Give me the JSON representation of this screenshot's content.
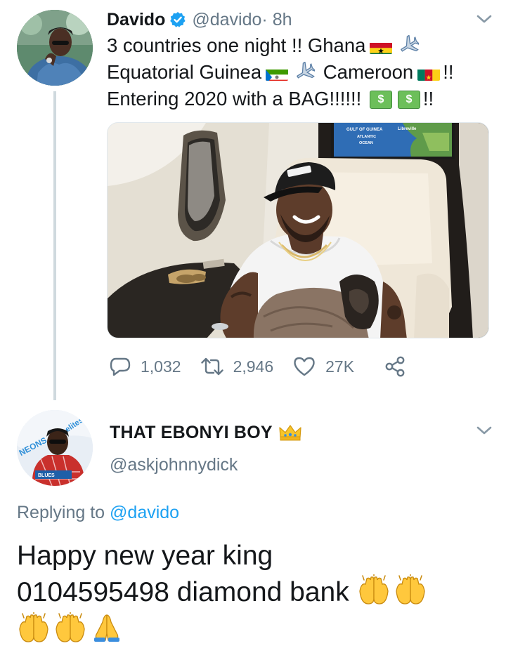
{
  "tweet": {
    "author": {
      "display_name": "Davido",
      "handle": "@davido",
      "time": " · 8h"
    },
    "text": {
      "line1": "3 countries one night !! Ghana",
      "line2_a": "Equatorial Guinea",
      "line2_b": "Cameroon",
      "line2_c": "!!",
      "line3": "Entering 2020 with a BAG!!!!!!",
      "line3_end": "!!"
    },
    "money_symbol": "$",
    "photo_screen": {
      "line1": "GULF OF GUINEA",
      "line2": "ATLANTIC",
      "line3": "OCEAN",
      "city": "Libreville"
    },
    "stats": {
      "replies": "1,032",
      "retweets": "2,946",
      "likes": "27K"
    },
    "icons": {
      "verified": "verified-badge-icon",
      "chevron": "chevron-down-icon",
      "reply": "reply-icon",
      "retweet": "retweet-icon",
      "like": "heart-icon",
      "share": "share-icon",
      "plane": "airplane-emoji",
      "crown": "crown-emoji",
      "hands": "raising-hands-emoji",
      "pray": "folded-hands-emoji"
    },
    "flags": [
      "Ghana",
      "Equatorial Guinea",
      "Cameroon"
    ]
  },
  "reply": {
    "author": {
      "display_name": "THAT EBONYI BOY",
      "handle": "@askjohnnydick"
    },
    "replying_prefix": "Replying to ",
    "replying_to": "@davido",
    "text_line1": "Happy new year king",
    "text_line2": "0104595498 diamond bank",
    "avatar_banner": "BLUES"
  },
  "colors": {
    "link": "#1da1f2",
    "secondary": "#657786",
    "text": "#14171a",
    "verified": "#1da1f2"
  }
}
